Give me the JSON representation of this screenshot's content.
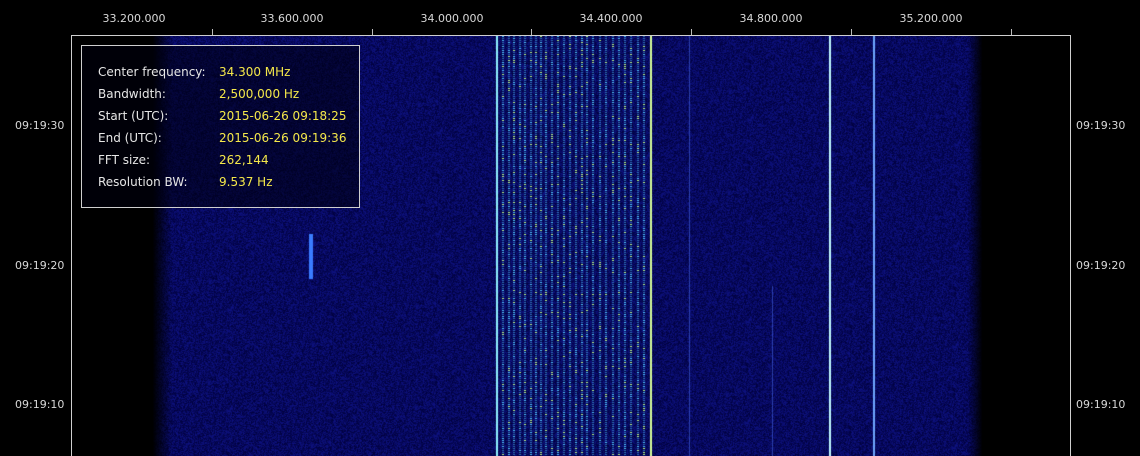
{
  "frequency_axis": {
    "labels": [
      "33.200.000",
      "33.600.000",
      "34.000.000",
      "34.400.000",
      "34.800.000",
      "35.200.000"
    ]
  },
  "time_axis": {
    "labels": [
      "09:19:30",
      "09:19:20",
      "09:19:10"
    ]
  },
  "info_box": {
    "rows": [
      {
        "key": "Center frequency:",
        "value": "34.300 MHz"
      },
      {
        "key": "Bandwidth:",
        "value": "2,500,000 Hz"
      },
      {
        "key": "Start (UTC):",
        "value": "2015-06-26 09:18:25"
      },
      {
        "key": "End (UTC):",
        "value": "2015-06-26 09:19:36"
      },
      {
        "key": "FFT size:",
        "value": "262,144"
      },
      {
        "key": "Resolution BW:",
        "value": "9.537 Hz"
      }
    ]
  },
  "colors": {
    "background": "#000000",
    "noise": "#10107a",
    "signal_bright": "#7fe0ff",
    "label_value": "#f5e84a"
  }
}
